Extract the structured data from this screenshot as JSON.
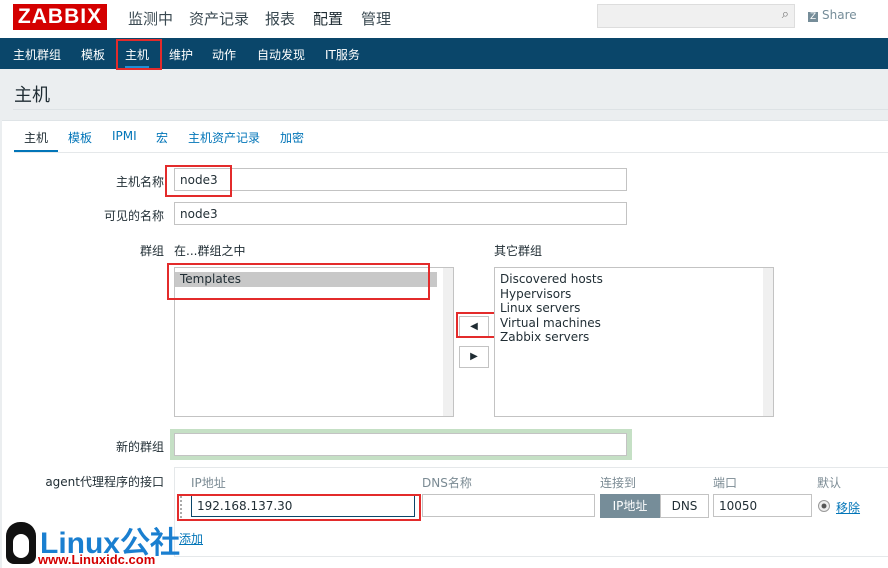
{
  "logo": "ZABBIX",
  "main_menu": [
    "监测中",
    "资产记录",
    "报表",
    "配置",
    "管理"
  ],
  "share": "Share",
  "sub_menu": [
    "主机群组",
    "模板",
    "主机",
    "维护",
    "动作",
    "自动发现",
    "IT服务"
  ],
  "page_title": "主机",
  "tabs": [
    "主机",
    "模板",
    "IPMI",
    "宏",
    "主机资产记录",
    "加密"
  ],
  "form": {
    "host_name_label": "主机名称",
    "host_name": "node3",
    "visible_name_label": "可见的名称",
    "visible_name": "node3",
    "groups_label": "群组",
    "in_groups_label": "在...群组之中",
    "other_groups_label": "其它群组",
    "in_groups": [
      "Templates"
    ],
    "other_groups": [
      "Discovered hosts",
      "Hypervisors",
      "Linux servers",
      "Virtual machines",
      "Zabbix servers"
    ],
    "new_group_label": "新的群组",
    "new_group": "",
    "agent_label": "agent代理程序的接口",
    "col_ip": "IP地址",
    "col_dns": "DNS名称",
    "col_connect": "连接到",
    "col_port": "端口",
    "col_default": "默认",
    "ip": "192.168.137.30",
    "dns": "",
    "connect_ip": "IP地址",
    "connect_dns": "DNS",
    "port": "10050",
    "remove": "移除",
    "add": "添加"
  },
  "watermark": {
    "brand": "Linux公社",
    "url": "www.Linuxidc.com"
  }
}
